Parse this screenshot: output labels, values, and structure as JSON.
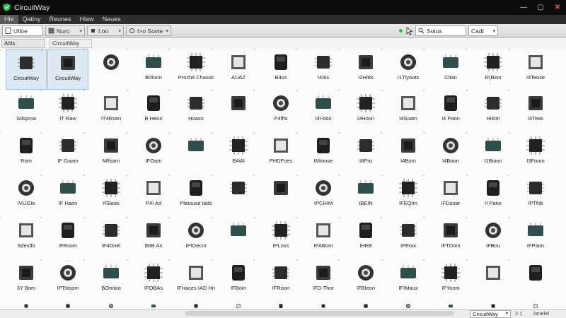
{
  "window": {
    "title": "CircuitWay"
  },
  "menu": [
    "Hle",
    "Qatiny",
    "Reunes",
    "Hlaw",
    "Neues"
  ],
  "toolbar": {
    "field1": "Utloe",
    "field2": "Nuro",
    "field3": "I.oo",
    "field4": "I>o Sovte",
    "search_placeholder": "Sotus",
    "right_value": "Cadt"
  },
  "tabs": {
    "left": "Aitts",
    "right": "CircuitWay"
  },
  "items": [
    [
      "CircuitWay",
      "CircuitWay",
      "",
      "B0tonn",
      "Prochit Chassk",
      "AUAZ",
      "B4ss",
      "I4I6s",
      "I2Hl8s",
      "I1Tlyoots",
      "Cltan",
      "R(Bion",
      "I4Teose"
    ],
    [
      "Sdsproa",
      "IT Raw",
      "IT4Rsen",
      "B Heon",
      "Hoasn",
      "",
      "P4ffts",
      "I4I-boo",
      "I3Hoon",
      "I4Soam",
      "I4 Paon",
      "Hilom",
      "I4Teas"
    ],
    [
      "Rom",
      "IF Gaam",
      "Mlfsam",
      "IFGam",
      "",
      "B4iAl",
      "PHDFoes",
      "IMtoose",
      "I8Pro",
      "I4Bom",
      "I4Boon",
      "I1Bioon",
      "I3Foom"
    ],
    [
      "IVLlGIe",
      "IF Haon",
      "IFBeas",
      "P4I Ad",
      "Platouse tads",
      "",
      "",
      "IPCHIM",
      "IBEIN",
      "IFEQIm",
      "IFDsoar",
      "II Pane",
      "IPTfdk"
    ],
    [
      "Sdestfo",
      "IFRsom",
      "IF4Dnel",
      "IBIB An",
      "IPIDecm",
      "",
      "IPLoss",
      "IFABom",
      "IHEB",
      "IFEooi",
      "IFTDom",
      "IFBou",
      "IFPaon"
    ],
    [
      "3Y Bom",
      "IPTstoom",
      "BOmtoo",
      "IFOBAs",
      "IFHaces IAD Hn",
      "IFBom",
      "IFRoon",
      "IFD-Thor",
      "IFBIeon",
      "IFIMaux",
      "IFYoom",
      "",
      ""
    ]
  ],
  "status": {
    "zone": "CircuitWay",
    "count": "2 1",
    "mode": "Ianelel"
  },
  "colors": {
    "titlebar": "#0c0c0c",
    "menubar": "#2d2d2d",
    "accent": "#dce8f4",
    "logo": "#21c24a"
  }
}
